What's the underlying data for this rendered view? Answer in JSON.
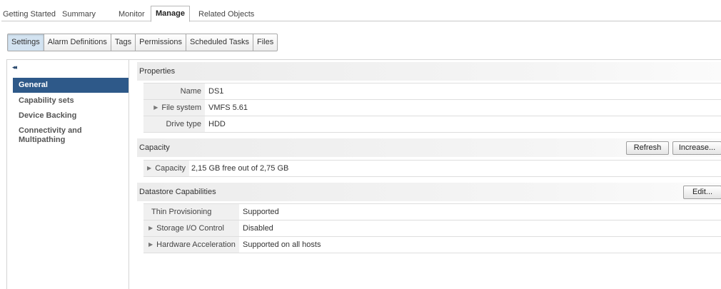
{
  "top_tabs": [
    {
      "label": "Getting Started"
    },
    {
      "label": "Summary"
    },
    {
      "label": "Monitor"
    },
    {
      "label": "Manage"
    },
    {
      "label": "Related Objects"
    }
  ],
  "sub_tabs": [
    {
      "label": "Settings"
    },
    {
      "label": "Alarm Definitions"
    },
    {
      "label": "Tags"
    },
    {
      "label": "Permissions"
    },
    {
      "label": "Scheduled Tasks"
    },
    {
      "label": "Files"
    }
  ],
  "left_nav": {
    "collapse_glyph": "◂◂",
    "items": [
      {
        "label": "General"
      },
      {
        "label": "Capability sets"
      },
      {
        "label": "Device Backing"
      },
      {
        "label": "Connectivity and"
      },
      {
        "label": "Multipathing"
      }
    ]
  },
  "properties": {
    "title": "Properties",
    "rows": [
      {
        "label": "Name",
        "value": "DS1"
      },
      {
        "label": "File system",
        "value": "VMFS 5.61"
      },
      {
        "label": "Drive type",
        "value": "HDD"
      }
    ]
  },
  "capacity": {
    "title": "Capacity",
    "refresh_label": "Refresh",
    "increase_label": "Increase...",
    "row": {
      "label": "Capacity",
      "value": "2,15 GB free out of 2,75 GB"
    }
  },
  "capabilities": {
    "title": "Datastore Capabilities",
    "edit_label": "Edit...",
    "rows": [
      {
        "label": "Thin Provisioning",
        "value": "Supported"
      },
      {
        "label": "Storage I/O Control",
        "value": "Disabled"
      },
      {
        "label": "Hardware Acceleration",
        "value": "Supported on all hosts"
      }
    ]
  },
  "expander_glyph": "▶",
  "colors": {
    "accent": "#2e5989",
    "selected_subtab": "#d3e3f1"
  }
}
